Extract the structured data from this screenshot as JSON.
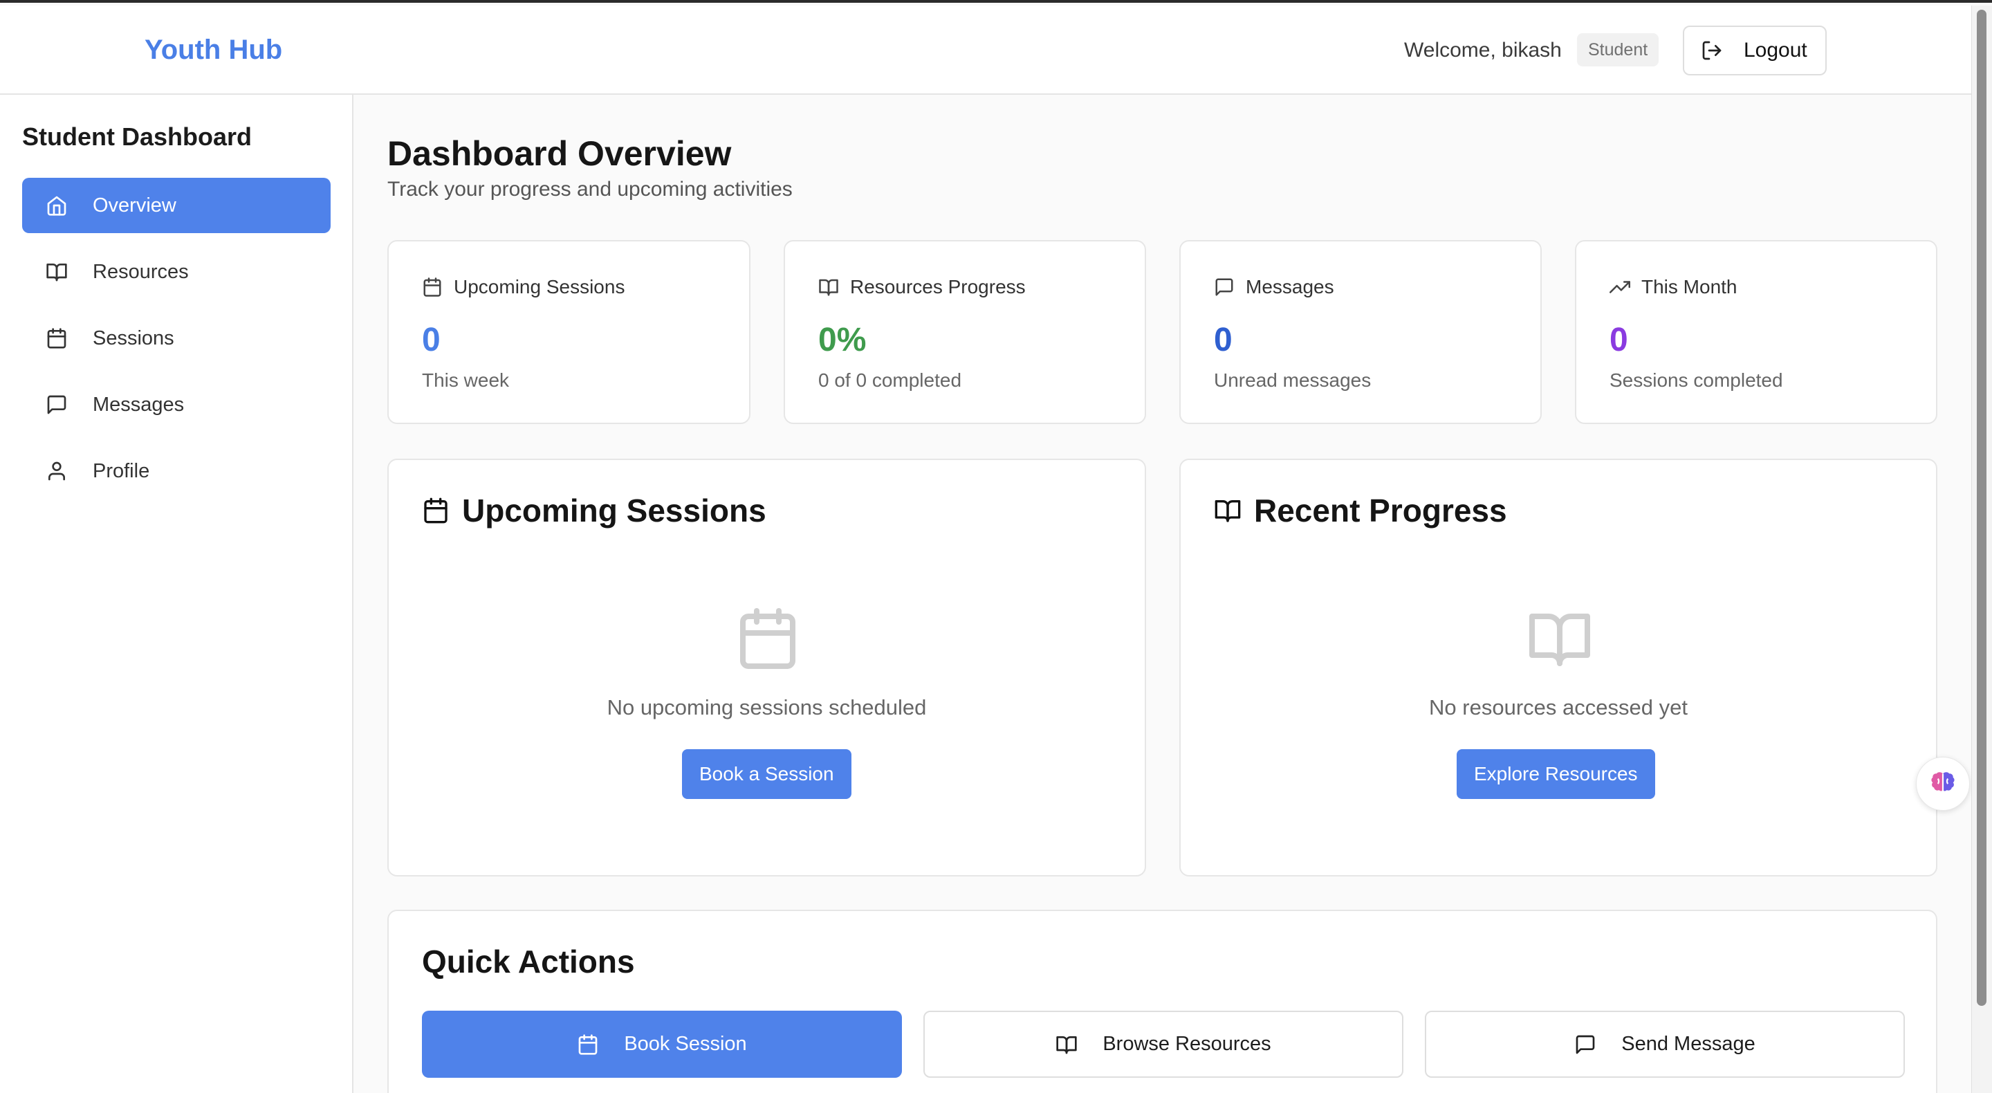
{
  "header": {
    "brand": "Youth Hub",
    "welcome_text": "Welcome, bikash",
    "role_badge": "Student",
    "logout_label": "Logout"
  },
  "sidebar": {
    "title": "Student Dashboard",
    "items": [
      {
        "label": "Overview",
        "icon": "home-icon",
        "active": true
      },
      {
        "label": "Resources",
        "icon": "book-icon",
        "active": false
      },
      {
        "label": "Sessions",
        "icon": "calendar-icon",
        "active": false
      },
      {
        "label": "Messages",
        "icon": "message-icon",
        "active": false
      },
      {
        "label": "Profile",
        "icon": "user-icon",
        "active": false
      }
    ]
  },
  "main": {
    "title": "Dashboard Overview",
    "subtitle": "Track your progress and upcoming activities",
    "stats": [
      {
        "label": "Upcoming Sessions",
        "icon": "calendar-icon",
        "value": "0",
        "note": "This week",
        "color": "#4a7fe6"
      },
      {
        "label": "Resources Progress",
        "icon": "book-icon",
        "value": "0%",
        "note": "0 of 0 completed",
        "color": "#3f9b4d"
      },
      {
        "label": "Messages",
        "icon": "message-icon",
        "value": "0",
        "note": "Unread messages",
        "color": "#2f5fd0"
      },
      {
        "label": "This Month",
        "icon": "trending-up-icon",
        "value": "0",
        "note": "Sessions completed",
        "color": "#8a3be0"
      }
    ],
    "upcoming_sessions": {
      "title": "Upcoming Sessions",
      "empty_text": "No upcoming sessions scheduled",
      "button_label": "Book a Session"
    },
    "recent_progress": {
      "title": "Recent Progress",
      "empty_text": "No resources accessed yet",
      "button_label": "Explore Resources"
    },
    "quick_actions": {
      "title": "Quick Actions",
      "buttons": [
        {
          "label": "Book Session",
          "icon": "calendar-icon",
          "style": "primary"
        },
        {
          "label": "Browse Resources",
          "icon": "book-icon",
          "style": "outline"
        },
        {
          "label": "Send Message",
          "icon": "message-icon",
          "style": "outline"
        }
      ]
    }
  },
  "colors": {
    "accent": "#4f82ea",
    "brand": "#4a7fe6"
  }
}
